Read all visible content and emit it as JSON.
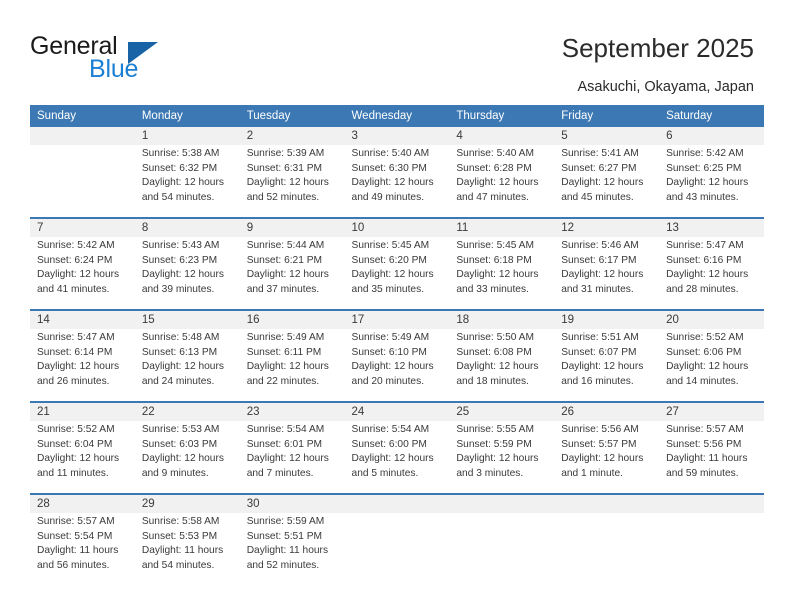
{
  "brand": {
    "name_top": "General",
    "name_bottom": "Blue",
    "triangle_color": "#1763a6",
    "blue_text_color": "#1b7fd4"
  },
  "header": {
    "title": "September 2025",
    "subtitle": "Asakuchi, Okayama, Japan",
    "header_bg": "#3c78b4",
    "daynum_bg": "#f1f1f1"
  },
  "weekdays": [
    "Sunday",
    "Monday",
    "Tuesday",
    "Wednesday",
    "Thursday",
    "Friday",
    "Saturday"
  ],
  "weeks": [
    [
      {
        "day": "",
        "l1": "",
        "l2": "",
        "l3": "",
        "l4": ""
      },
      {
        "day": "1",
        "l1": "Sunrise: 5:38 AM",
        "l2": "Sunset: 6:32 PM",
        "l3": "Daylight: 12 hours",
        "l4": "and 54 minutes."
      },
      {
        "day": "2",
        "l1": "Sunrise: 5:39 AM",
        "l2": "Sunset: 6:31 PM",
        "l3": "Daylight: 12 hours",
        "l4": "and 52 minutes."
      },
      {
        "day": "3",
        "l1": "Sunrise: 5:40 AM",
        "l2": "Sunset: 6:30 PM",
        "l3": "Daylight: 12 hours",
        "l4": "and 49 minutes."
      },
      {
        "day": "4",
        "l1": "Sunrise: 5:40 AM",
        "l2": "Sunset: 6:28 PM",
        "l3": "Daylight: 12 hours",
        "l4": "and 47 minutes."
      },
      {
        "day": "5",
        "l1": "Sunrise: 5:41 AM",
        "l2": "Sunset: 6:27 PM",
        "l3": "Daylight: 12 hours",
        "l4": "and 45 minutes."
      },
      {
        "day": "6",
        "l1": "Sunrise: 5:42 AM",
        "l2": "Sunset: 6:25 PM",
        "l3": "Daylight: 12 hours",
        "l4": "and 43 minutes."
      }
    ],
    [
      {
        "day": "7",
        "l1": "Sunrise: 5:42 AM",
        "l2": "Sunset: 6:24 PM",
        "l3": "Daylight: 12 hours",
        "l4": "and 41 minutes."
      },
      {
        "day": "8",
        "l1": "Sunrise: 5:43 AM",
        "l2": "Sunset: 6:23 PM",
        "l3": "Daylight: 12 hours",
        "l4": "and 39 minutes."
      },
      {
        "day": "9",
        "l1": "Sunrise: 5:44 AM",
        "l2": "Sunset: 6:21 PM",
        "l3": "Daylight: 12 hours",
        "l4": "and 37 minutes."
      },
      {
        "day": "10",
        "l1": "Sunrise: 5:45 AM",
        "l2": "Sunset: 6:20 PM",
        "l3": "Daylight: 12 hours",
        "l4": "and 35 minutes."
      },
      {
        "day": "11",
        "l1": "Sunrise: 5:45 AM",
        "l2": "Sunset: 6:18 PM",
        "l3": "Daylight: 12 hours",
        "l4": "and 33 minutes."
      },
      {
        "day": "12",
        "l1": "Sunrise: 5:46 AM",
        "l2": "Sunset: 6:17 PM",
        "l3": "Daylight: 12 hours",
        "l4": "and 31 minutes."
      },
      {
        "day": "13",
        "l1": "Sunrise: 5:47 AM",
        "l2": "Sunset: 6:16 PM",
        "l3": "Daylight: 12 hours",
        "l4": "and 28 minutes."
      }
    ],
    [
      {
        "day": "14",
        "l1": "Sunrise: 5:47 AM",
        "l2": "Sunset: 6:14 PM",
        "l3": "Daylight: 12 hours",
        "l4": "and 26 minutes."
      },
      {
        "day": "15",
        "l1": "Sunrise: 5:48 AM",
        "l2": "Sunset: 6:13 PM",
        "l3": "Daylight: 12 hours",
        "l4": "and 24 minutes."
      },
      {
        "day": "16",
        "l1": "Sunrise: 5:49 AM",
        "l2": "Sunset: 6:11 PM",
        "l3": "Daylight: 12 hours",
        "l4": "and 22 minutes."
      },
      {
        "day": "17",
        "l1": "Sunrise: 5:49 AM",
        "l2": "Sunset: 6:10 PM",
        "l3": "Daylight: 12 hours",
        "l4": "and 20 minutes."
      },
      {
        "day": "18",
        "l1": "Sunrise: 5:50 AM",
        "l2": "Sunset: 6:08 PM",
        "l3": "Daylight: 12 hours",
        "l4": "and 18 minutes."
      },
      {
        "day": "19",
        "l1": "Sunrise: 5:51 AM",
        "l2": "Sunset: 6:07 PM",
        "l3": "Daylight: 12 hours",
        "l4": "and 16 minutes."
      },
      {
        "day": "20",
        "l1": "Sunrise: 5:52 AM",
        "l2": "Sunset: 6:06 PM",
        "l3": "Daylight: 12 hours",
        "l4": "and 14 minutes."
      }
    ],
    [
      {
        "day": "21",
        "l1": "Sunrise: 5:52 AM",
        "l2": "Sunset: 6:04 PM",
        "l3": "Daylight: 12 hours",
        "l4": "and 11 minutes."
      },
      {
        "day": "22",
        "l1": "Sunrise: 5:53 AM",
        "l2": "Sunset: 6:03 PM",
        "l3": "Daylight: 12 hours",
        "l4": "and 9 minutes."
      },
      {
        "day": "23",
        "l1": "Sunrise: 5:54 AM",
        "l2": "Sunset: 6:01 PM",
        "l3": "Daylight: 12 hours",
        "l4": "and 7 minutes."
      },
      {
        "day": "24",
        "l1": "Sunrise: 5:54 AM",
        "l2": "Sunset: 6:00 PM",
        "l3": "Daylight: 12 hours",
        "l4": "and 5 minutes."
      },
      {
        "day": "25",
        "l1": "Sunrise: 5:55 AM",
        "l2": "Sunset: 5:59 PM",
        "l3": "Daylight: 12 hours",
        "l4": "and 3 minutes."
      },
      {
        "day": "26",
        "l1": "Sunrise: 5:56 AM",
        "l2": "Sunset: 5:57 PM",
        "l3": "Daylight: 12 hours",
        "l4": "and 1 minute."
      },
      {
        "day": "27",
        "l1": "Sunrise: 5:57 AM",
        "l2": "Sunset: 5:56 PM",
        "l3": "Daylight: 11 hours",
        "l4": "and 59 minutes."
      }
    ],
    [
      {
        "day": "28",
        "l1": "Sunrise: 5:57 AM",
        "l2": "Sunset: 5:54 PM",
        "l3": "Daylight: 11 hours",
        "l4": "and 56 minutes."
      },
      {
        "day": "29",
        "l1": "Sunrise: 5:58 AM",
        "l2": "Sunset: 5:53 PM",
        "l3": "Daylight: 11 hours",
        "l4": "and 54 minutes."
      },
      {
        "day": "30",
        "l1": "Sunrise: 5:59 AM",
        "l2": "Sunset: 5:51 PM",
        "l3": "Daylight: 11 hours",
        "l4": "and 52 minutes."
      },
      {
        "day": "",
        "l1": "",
        "l2": "",
        "l3": "",
        "l4": ""
      },
      {
        "day": "",
        "l1": "",
        "l2": "",
        "l3": "",
        "l4": ""
      },
      {
        "day": "",
        "l1": "",
        "l2": "",
        "l3": "",
        "l4": ""
      },
      {
        "day": "",
        "l1": "",
        "l2": "",
        "l3": "",
        "l4": ""
      }
    ]
  ]
}
